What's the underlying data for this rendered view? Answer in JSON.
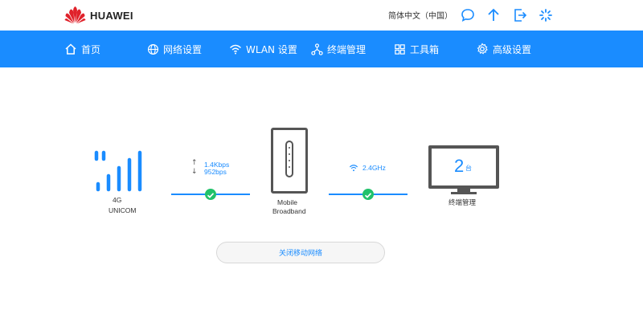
{
  "brand": {
    "name": "HUAWEI"
  },
  "header": {
    "language": "简体中文（中国）",
    "icons": [
      "chat-icon",
      "upload-arrow-icon",
      "logout-icon",
      "loading-icon"
    ]
  },
  "nav": {
    "items": [
      {
        "label": "首页",
        "icon": "home-icon"
      },
      {
        "label": "网络设置",
        "icon": "globe-icon"
      },
      {
        "label": "WLAN 设置",
        "icon": "wifi-icon"
      },
      {
        "label": "终端管理",
        "icon": "network-icon"
      },
      {
        "label": "工具箱",
        "icon": "grid-icon"
      },
      {
        "label": "高级设置",
        "icon": "gear-icon"
      }
    ]
  },
  "status": {
    "network_type": "4G",
    "carrier": "UNICOM",
    "upload_rate": "1.4Kbps",
    "download_rate": "952bps",
    "device_name_line1": "Mobile",
    "device_name_line2": "Broadband",
    "wifi_band": "2.4GHz",
    "device_count": "2",
    "device_count_unit": "台",
    "device_label": "终端管理"
  },
  "actions": {
    "close_mobile_network": "关闭移动网络"
  },
  "colors": {
    "accent": "#1a8cff",
    "success": "#21c26b",
    "icon_gray": "#555555",
    "brand_red": "#e0222b"
  }
}
